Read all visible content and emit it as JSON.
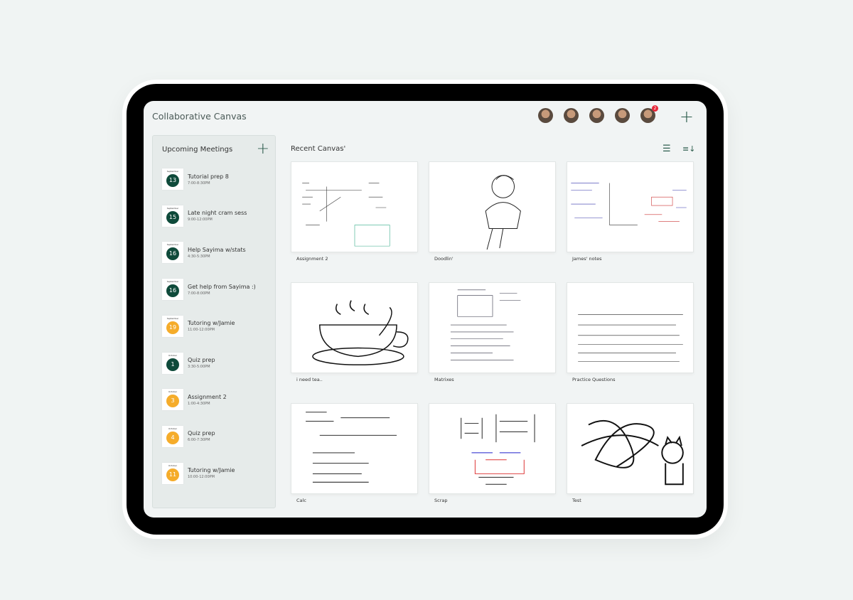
{
  "app": {
    "title": "Collaborative Canvas",
    "collaborators": [
      {
        "name": "collaborator-1"
      },
      {
        "name": "collaborator-2"
      },
      {
        "name": "collaborator-3"
      },
      {
        "name": "collaborator-4"
      },
      {
        "name": "collaborator-5",
        "badge": "2"
      }
    ]
  },
  "sidebar": {
    "title": "Upcoming Meetings",
    "meetings": [
      {
        "month": "September",
        "day": "13",
        "name": "Tutorial prep 8",
        "time": "7:00-8:30PM",
        "color": "#0e4a3a"
      },
      {
        "month": "September",
        "day": "15",
        "name": "Late night cram sess",
        "time": "9:00-12:00PM",
        "color": "#0e4a3a"
      },
      {
        "month": "September",
        "day": "16",
        "name": "Help Sayima w/stats",
        "time": "4:30-5:30PM",
        "color": "#0e4a3a"
      },
      {
        "month": "September",
        "day": "16",
        "name": "Get help from Sayima :)",
        "time": "7:00-8:00PM",
        "color": "#0e4a3a"
      },
      {
        "month": "September",
        "day": "19",
        "name": "Tutoring w/Jamie",
        "time": "11:00-12:00PM",
        "color": "#f5ac2a"
      },
      {
        "month": "October",
        "day": "1",
        "name": "Quiz prep",
        "time": "3:30-5:00PM",
        "color": "#0e4a3a"
      },
      {
        "month": "October",
        "day": "3",
        "name": "Assignment 2",
        "time": "1:00-4:30PM",
        "color": "#f5ac2a"
      },
      {
        "month": "October",
        "day": "4",
        "name": "Quiz prep",
        "time": "6:00-7:30PM",
        "color": "#f5ac2a"
      },
      {
        "month": "October",
        "day": "11",
        "name": "Tutoring w/Jamie",
        "time": "10:00-12:00PM",
        "color": "#f5ac2a"
      }
    ]
  },
  "main": {
    "title": "Recent Canvas'",
    "canvases": [
      {
        "name": "Assignment 2"
      },
      {
        "name": "Doodlin'"
      },
      {
        "name": "James' notes"
      },
      {
        "name": "i need tea.."
      },
      {
        "name": "Matrixes"
      },
      {
        "name": "Practice Questions"
      },
      {
        "name": "Calc"
      },
      {
        "name": "Scrap"
      },
      {
        "name": "Test"
      }
    ]
  },
  "icons": {
    "add": "plus-icon",
    "list": "list-view-icon",
    "sort": "sort-icon"
  },
  "colors": {
    "accent": "#2e5e4e",
    "dark_date": "#0e4a3a",
    "light_date": "#f5ac2a",
    "notification": "#e8283a"
  }
}
